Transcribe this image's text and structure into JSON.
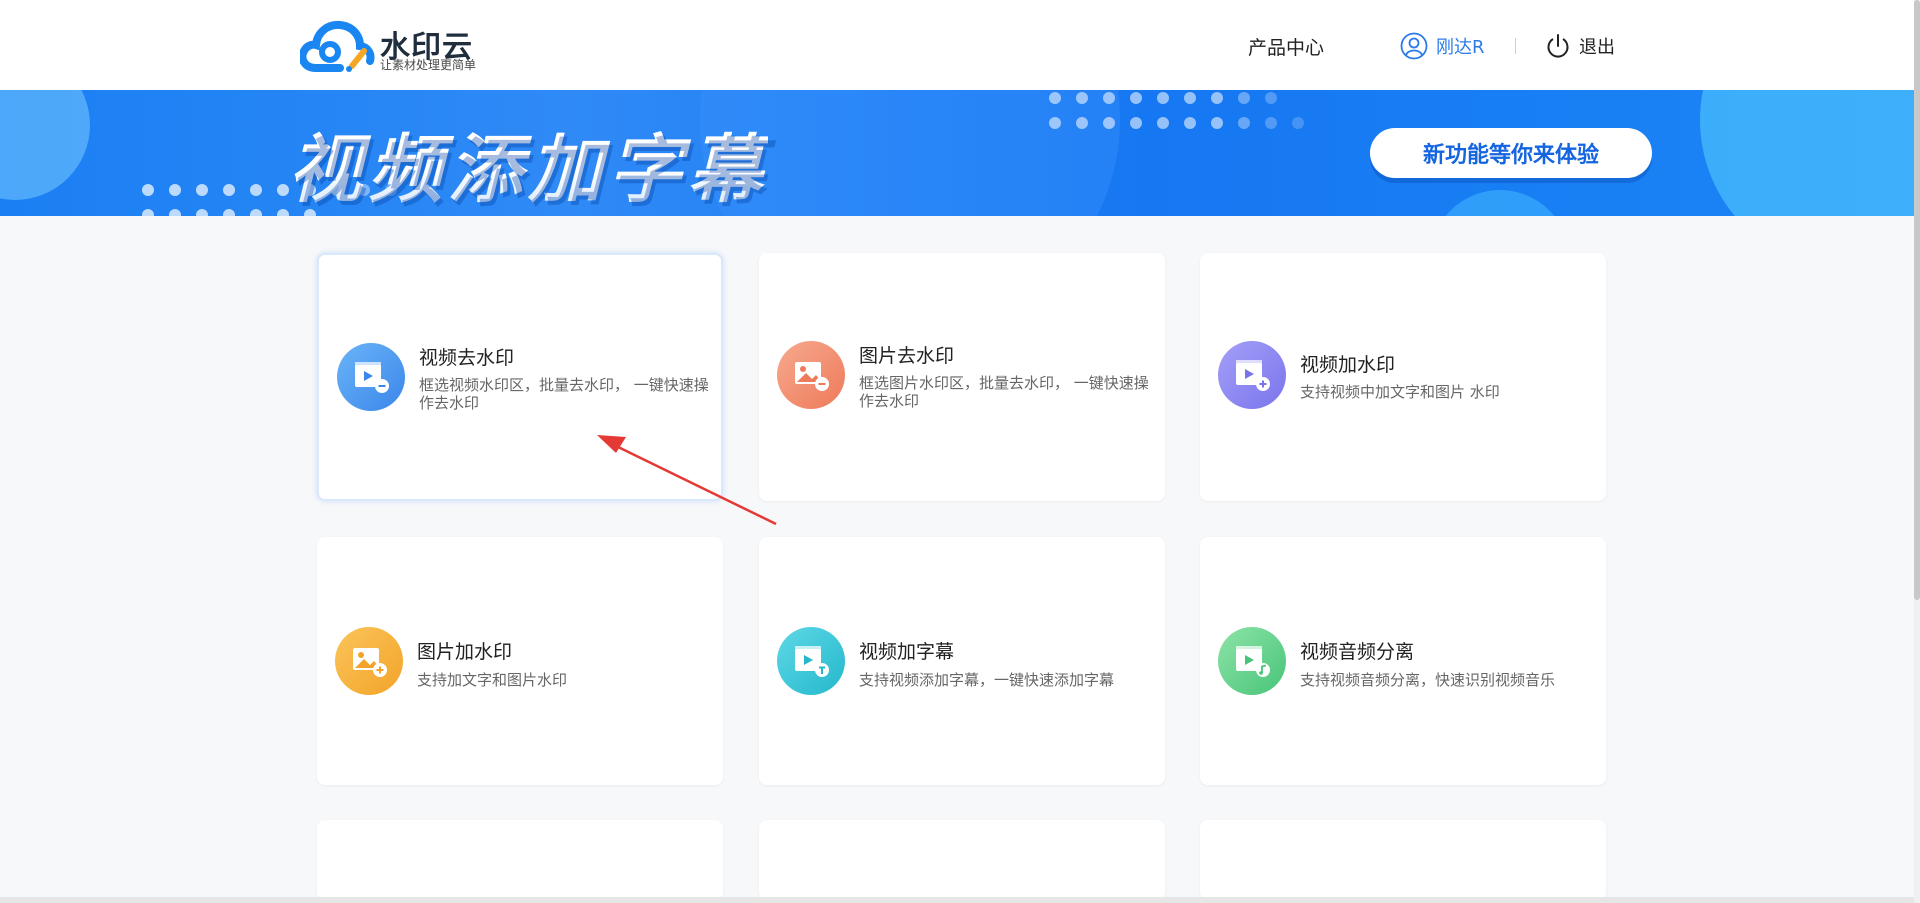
{
  "header": {
    "logo_title": "水印云",
    "logo_subtitle": "让素材处理更简单",
    "nav_product": "产品中心",
    "user_name": "刚达R",
    "logout": "退出"
  },
  "banner": {
    "title": "视频添加字幕",
    "cta": "新功能等你来体验"
  },
  "cards": [
    {
      "title": "视频去水印",
      "desc": "框选视频水印区，批量去水印， 一键快速操作去水印",
      "icon": "video-remove-icon",
      "color": "#4a9af0"
    },
    {
      "title": "图片去水印",
      "desc": "框选图片水印区，批量去水印， 一键快速操作去水印",
      "icon": "image-remove-icon",
      "color": "#f2896c"
    },
    {
      "title": "视频加水印",
      "desc": "支持视频中加文字和图片 水印",
      "icon": "video-add-icon",
      "color": "#8a86f0"
    },
    {
      "title": "图片加水印",
      "desc": "支持加文字和图片水印",
      "icon": "image-add-icon",
      "color": "#f5b13d"
    },
    {
      "title": "视频加字幕",
      "desc": "支持视频添加字幕，一键快速添加字幕",
      "icon": "video-subtitle-icon",
      "color": "#34c6d6"
    },
    {
      "title": "视频音频分离",
      "desc": "支持视频音频分离，快速识别视频音乐",
      "icon": "video-audio-split-icon",
      "color": "#5fd089"
    }
  ],
  "colors": {
    "accent": "#2b7bea",
    "banner_blue": "#1a7ff3",
    "arrow_red": "#e53935"
  }
}
